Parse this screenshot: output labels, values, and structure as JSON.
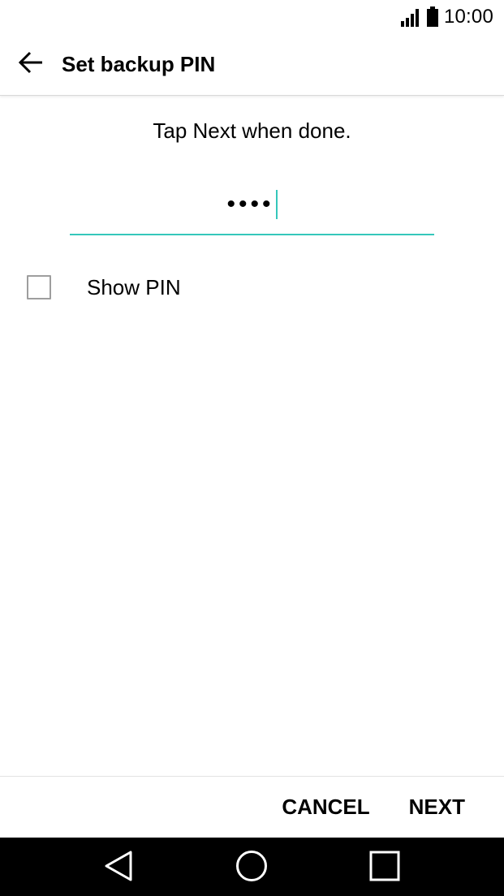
{
  "status_bar": {
    "time": "10:00",
    "icons": [
      "signal-icon",
      "battery-icon"
    ]
  },
  "app_bar": {
    "title": "Set backup PIN",
    "back_icon": "arrow-left-icon"
  },
  "content": {
    "instruction": "Tap Next when done.",
    "pin_display": "••••",
    "show_pin_label": "Show PIN",
    "show_pin_checked": false
  },
  "actions": {
    "cancel_label": "CANCEL",
    "next_label": "NEXT"
  },
  "nav_bar": {
    "icons": [
      "nav-back-icon",
      "nav-home-icon",
      "nav-recents-icon"
    ]
  },
  "colors": {
    "accent": "#35c7bb",
    "text": "#000000",
    "background": "#ffffff",
    "nav_background": "#000000"
  }
}
